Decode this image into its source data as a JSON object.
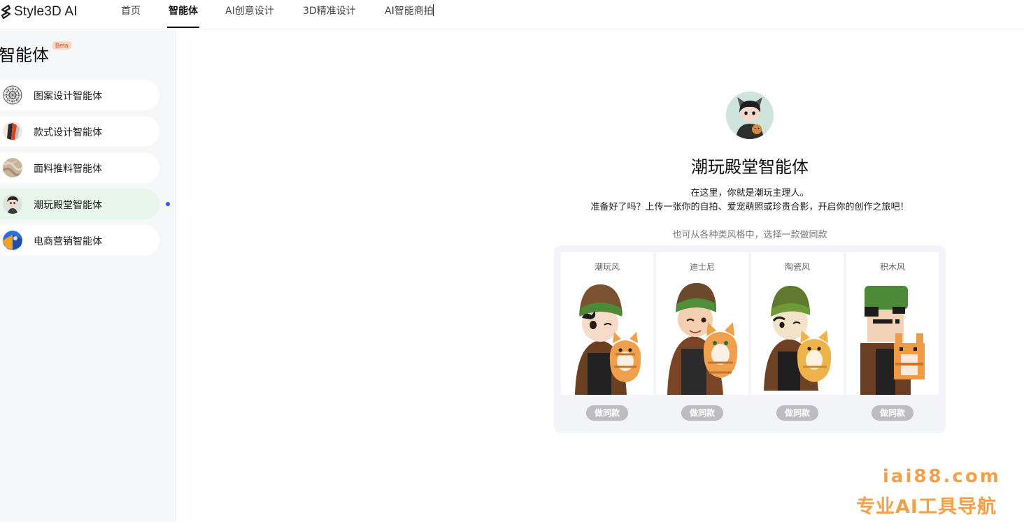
{
  "app": {
    "logo_text": "Style3D AI"
  },
  "nav": {
    "items": [
      {
        "label": "首页"
      },
      {
        "label": "智能体"
      },
      {
        "label": "AI创意设计"
      },
      {
        "label": "3D精准设计"
      },
      {
        "label": "AI智能商拍"
      }
    ],
    "active_index": 1
  },
  "sidebar": {
    "title": "智能体",
    "badge": "Beta",
    "items": [
      {
        "label": "图案设计智能体",
        "icon": "pattern-design-icon"
      },
      {
        "label": "款式设计智能体",
        "icon": "style-design-icon"
      },
      {
        "label": "面料推料智能体",
        "icon": "fabric-icon"
      },
      {
        "label": "潮玩殿堂智能体",
        "icon": "trendy-toy-icon"
      },
      {
        "label": "电商营销智能体",
        "icon": "ecommerce-icon"
      }
    ],
    "active_index": 3
  },
  "agent": {
    "title": "潮玩殿堂智能体",
    "desc_line1": "在这里，你就是潮玩主理人。",
    "desc_line2": "准备好了吗？上传一张你的自拍、爱宠萌照或珍贵合影，开启你的创作之旅吧！",
    "hint": "也可从各种类风格中，选择一款做同款"
  },
  "styles": [
    {
      "name": "潮玩风",
      "button": "做同款"
    },
    {
      "name": "迪士尼",
      "button": "做同款"
    },
    {
      "name": "陶瓷风",
      "button": "做同款"
    },
    {
      "name": "积木风",
      "button": "做同款"
    }
  ],
  "watermark": {
    "url": "iai88.com",
    "text": "专业AI工具导航"
  },
  "colors": {
    "active_item_bg": "#e8f6ec",
    "active_dot": "#2a54ff",
    "watermark": "#f0a14a"
  }
}
